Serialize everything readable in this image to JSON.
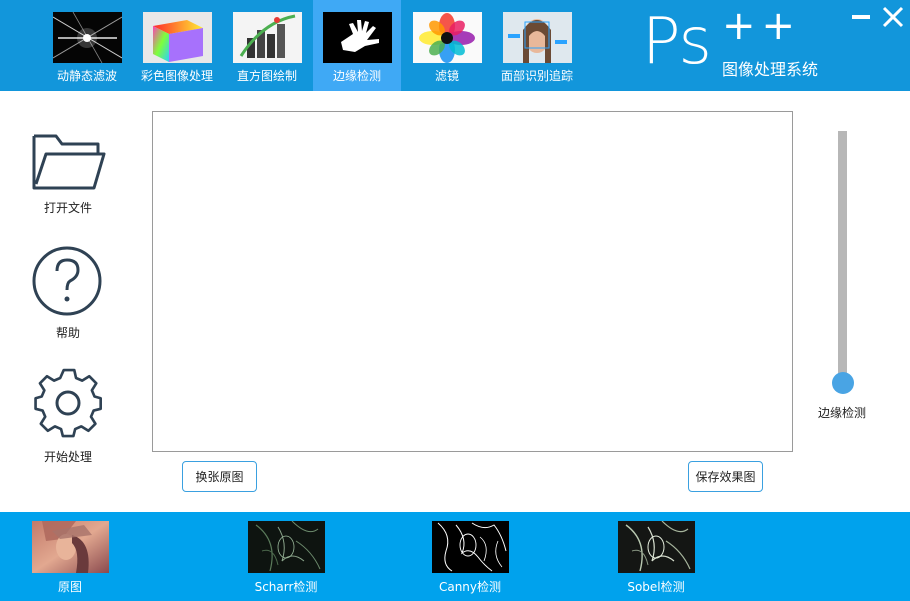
{
  "header": {
    "tabs": [
      {
        "label": "动静态滤波",
        "icon": "light-rays-thumbnail"
      },
      {
        "label": "彩色图像处理",
        "icon": "color-cube-thumbnail"
      },
      {
        "label": "直方图绘制",
        "icon": "histogram-thumbnail"
      },
      {
        "label": "边缘检测",
        "icon": "hand-edge-thumbnail"
      },
      {
        "label": "滤镜",
        "icon": "color-flower-thumbnail"
      },
      {
        "label": "面部识别追踪",
        "icon": "face-tracking-thumbnail"
      }
    ],
    "active_tab": 3,
    "logo": {
      "main": "Ps",
      "plus": "++",
      "subtitle": "图像处理系统"
    },
    "window_controls": {
      "minimize_icon": "minimize-icon",
      "close_icon": "close-icon"
    }
  },
  "sidebar": {
    "tools": [
      {
        "label": "打开文件",
        "icon": "folder-icon"
      },
      {
        "label": "帮助",
        "icon": "help-icon"
      },
      {
        "label": "开始处理",
        "icon": "gear-icon"
      }
    ]
  },
  "main": {
    "swap_button": "换张原图",
    "save_button": "保存效果图"
  },
  "slider": {
    "label": "边缘检测",
    "value_fraction": 0.0
  },
  "results": [
    {
      "label": "原图"
    },
    {
      "label": "Scharr检测"
    },
    {
      "label": "Canny检测"
    },
    {
      "label": "Sobel检测"
    }
  ],
  "colors": {
    "topbar": "#1296db",
    "active_tab": "#3fa9f5",
    "bottombar": "#00a2ed",
    "slider_handle": "#49a4e4",
    "button_border": "#3aa0e0"
  }
}
